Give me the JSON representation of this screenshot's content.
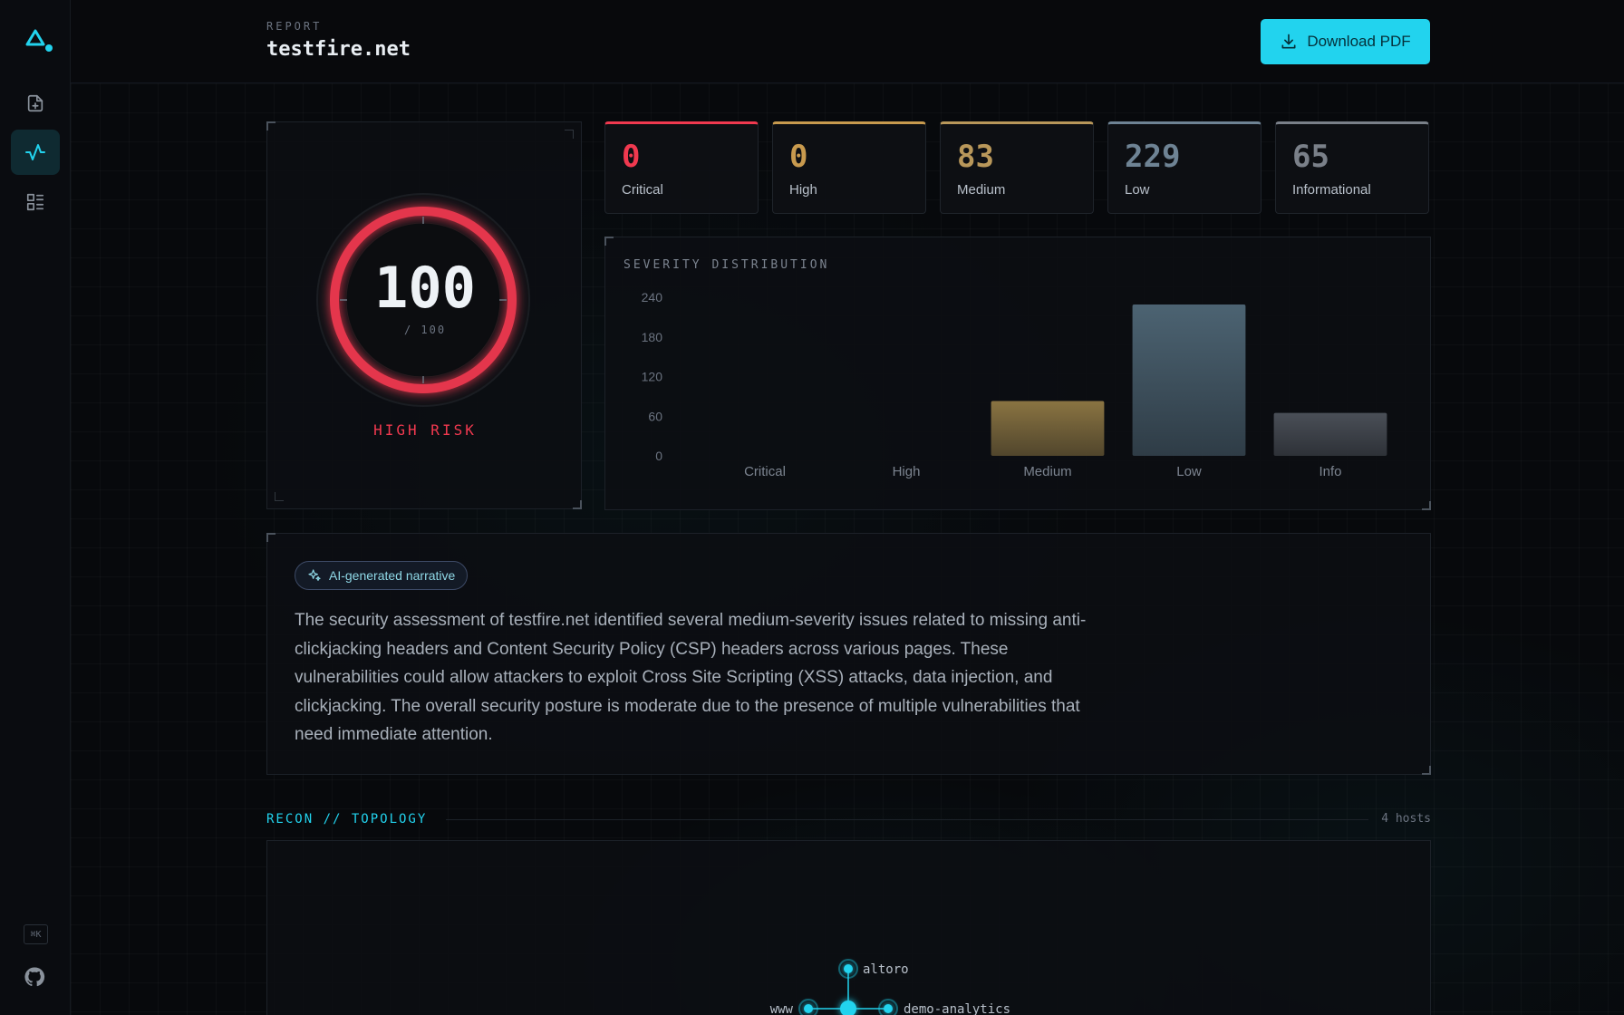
{
  "header": {
    "label": "REPORT",
    "title": "testfire.net",
    "download_label": "Download PDF"
  },
  "sidebar": {
    "items": [
      {
        "name": "new-report",
        "icon": "file-plus-icon"
      },
      {
        "name": "activity",
        "icon": "activity-icon",
        "active": true
      },
      {
        "name": "dashboard",
        "icon": "list-grid-icon"
      }
    ],
    "shortcut": "⌘K",
    "footer_icon": "github-icon"
  },
  "score": {
    "value": "100",
    "max": "/ 100",
    "risk": "HIGH RISK",
    "color": "#f0394f"
  },
  "stats": [
    {
      "value": "0",
      "label": "Critical",
      "color": "#f0394f"
    },
    {
      "value": "0",
      "label": "High",
      "color": "#c89a4e"
    },
    {
      "value": "83",
      "label": "Medium",
      "color": "#b8975a"
    },
    {
      "value": "229",
      "label": "Low",
      "color": "#6e8394"
    },
    {
      "value": "65",
      "label": "Informational",
      "color": "#7a8089"
    }
  ],
  "chart_data": {
    "type": "bar",
    "title": "SEVERITY DISTRIBUTION",
    "categories": [
      "Critical",
      "High",
      "Medium",
      "Low",
      "Info"
    ],
    "values": [
      0,
      0,
      83,
      229,
      65
    ],
    "ylim": [
      0,
      240
    ],
    "yticks": [
      0,
      60,
      120,
      180,
      240
    ],
    "colors": [
      "#f0394f",
      "#c89a4e",
      "#8a7442",
      "#4c6372",
      "#4a4f57"
    ],
    "grid": false
  },
  "narrative": {
    "badge": "AI-generated narrative",
    "text": "The security assessment of testfire.net identified several medium-severity issues related to missing anti-clickjacking headers and Content Security Policy (CSP) headers across various pages. These vulnerabilities could allow attackers to exploit Cross Site Scripting (XSS) attacks, data injection, and clickjacking. The overall security posture is moderate due to the presence of multiple vulnerabilities that need immediate attention."
  },
  "topology": {
    "title": "RECON // TOPOLOGY",
    "host_count": "4 hosts",
    "nodes": [
      "altoro",
      "www",
      "demo-analytics"
    ]
  }
}
